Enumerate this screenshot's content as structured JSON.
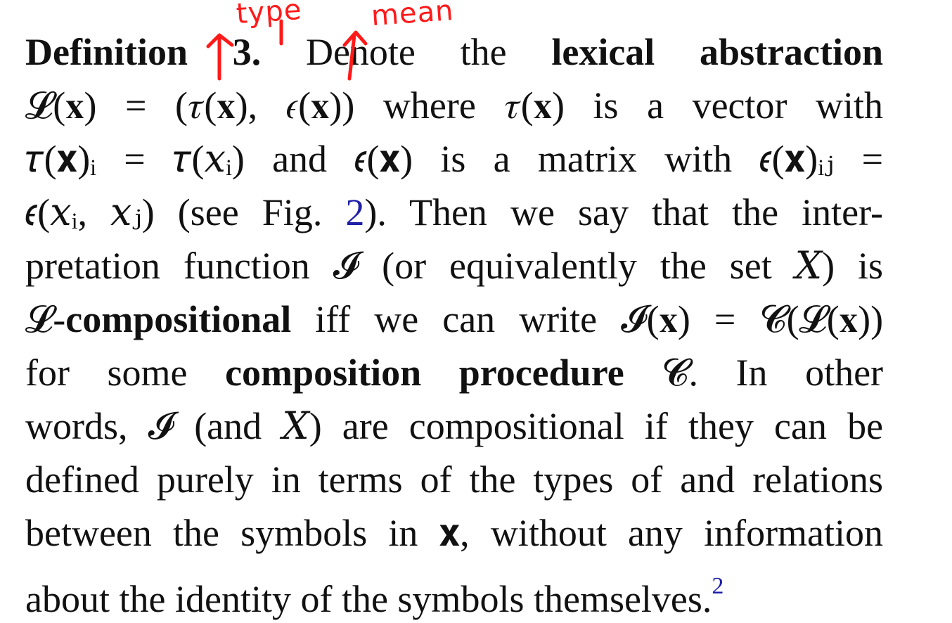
{
  "definition": {
    "label": "Definition 3.",
    "lines": [
      {
        "segments": [
          {
            "t": "Definition 3.",
            "s": "b"
          },
          {
            "t": "Denote"
          },
          {
            "t": "the"
          },
          {
            "t": "lexical",
            "s": "b"
          },
          {
            "t": "abstraction",
            "s": "b"
          }
        ]
      },
      {
        "segments": [
          {
            "t": "𝓛(𝐱) = (𝜏(𝐱), 𝜖(𝐱))"
          },
          {
            "t": "where"
          },
          {
            "t": "𝜏(𝐱)"
          },
          {
            "t": "is"
          },
          {
            "t": "a"
          },
          {
            "t": "vector"
          },
          {
            "t": "with"
          }
        ]
      },
      {
        "segments": [
          {
            "t": "𝜏(𝐱)ᵢ = 𝜏(𝑥ᵢ)"
          },
          {
            "t": "and"
          },
          {
            "t": "𝜖(𝐱)"
          },
          {
            "t": "is"
          },
          {
            "t": "a"
          },
          {
            "t": "matrix"
          },
          {
            "t": "with"
          },
          {
            "t": "𝜖(𝐱)ᵢⱼ ="
          }
        ]
      },
      {
        "segments": [
          {
            "t": "𝜖(𝑥ᵢ, 𝑥ⱼ)"
          },
          {
            "t": "(see"
          },
          {
            "t": "Fig."
          },
          {
            "t": "2",
            "s": "link",
            "join": ")."
          },
          {
            "t": "Then"
          },
          {
            "t": "we"
          },
          {
            "t": "say"
          },
          {
            "t": "that"
          },
          {
            "t": "the"
          },
          {
            "t": "inter-"
          }
        ]
      },
      {
        "segments": [
          {
            "t": "pretation"
          },
          {
            "t": "function"
          },
          {
            "t": "𝓘"
          },
          {
            "t": "(or"
          },
          {
            "t": "equivalently"
          },
          {
            "t": "the"
          },
          {
            "t": "set"
          },
          {
            "t": "𝑋)"
          },
          {
            "t": "is"
          }
        ]
      },
      {
        "segments": [
          {
            "t": "𝓛-"
          },
          {
            "t": "compositional",
            "s": "b",
            "glue": true
          },
          {
            "t": "iff"
          },
          {
            "t": "we"
          },
          {
            "t": "can"
          },
          {
            "t": "write"
          },
          {
            "t": "𝓘(𝐱) = 𝓒(𝓛(𝐱))"
          }
        ]
      },
      {
        "segments": [
          {
            "t": "for"
          },
          {
            "t": "some"
          },
          {
            "t": "composition",
            "s": "b"
          },
          {
            "t": "procedure",
            "s": "b"
          },
          {
            "t": "𝓒."
          },
          {
            "t": "In"
          },
          {
            "t": "other"
          }
        ]
      },
      {
        "segments": [
          {
            "t": "words,"
          },
          {
            "t": "𝓘"
          },
          {
            "t": "(and"
          },
          {
            "t": "𝑋)"
          },
          {
            "t": "are"
          },
          {
            "t": "compositional"
          },
          {
            "t": "if"
          },
          {
            "t": "they"
          },
          {
            "t": "can"
          },
          {
            "t": "be"
          }
        ]
      },
      {
        "segments": [
          {
            "t": "defined"
          },
          {
            "t": "purely"
          },
          {
            "t": "in"
          },
          {
            "t": "terms"
          },
          {
            "t": "of"
          },
          {
            "t": "the"
          },
          {
            "t": "types"
          },
          {
            "t": "of"
          },
          {
            "t": "and"
          },
          {
            "t": "relations"
          }
        ]
      },
      {
        "segments": [
          {
            "t": "between"
          },
          {
            "t": "the"
          },
          {
            "t": "symbols"
          },
          {
            "t": "in"
          },
          {
            "t": "𝐱,"
          },
          {
            "t": "without"
          },
          {
            "t": "any"
          },
          {
            "t": "information"
          }
        ]
      },
      {
        "segments": [
          {
            "t": "about"
          },
          {
            "t": "the"
          },
          {
            "t": "identity"
          },
          {
            "t": "of"
          },
          {
            "t": "the"
          },
          {
            "t": "symbols"
          },
          {
            "t": "themselves."
          },
          {
            "t": "2",
            "s": "fn",
            "glue": true
          }
        ],
        "last": true
      }
    ]
  },
  "annotations": {
    "type_label": "type",
    "mean_label": "mean",
    "ink_color": "#ff1a1a"
  },
  "colors": {
    "text": "#111111",
    "link": "#1f1fa8",
    "background": "#ffffff"
  }
}
